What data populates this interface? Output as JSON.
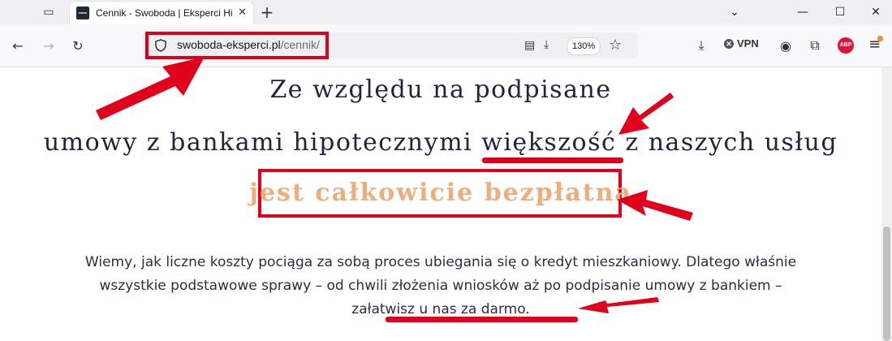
{
  "browser": {
    "tab_title": "Cennik - Swoboda | Eksperci Hipoteczni",
    "url_domain": "swoboda-eksperci.pl",
    "url_path": "/cennik/",
    "zoom": "130%",
    "vpn_label": "VPN",
    "abp_label": "ABP"
  },
  "page": {
    "heading_line1": "Ze względu na podpisane",
    "heading_line2": "umowy z bankami hipotecznymi większość z naszych usług",
    "heading_line3": "jest całkowicie bezpłatna",
    "paragraph": "Wiemy, jak liczne koszty pociąga za sobą proces ubiegania się o kredyt mieszkaniowy. Dlatego właśnie wszystkie podstawowe sprawy – od chwili złożenia wniosków aż po podpisanie umowy z bankiem – załatwisz u nas za darmo."
  },
  "colors": {
    "annotation_red": "#e0001b",
    "heading_navy": "#22233f",
    "accent_peach": "#edae7c"
  }
}
